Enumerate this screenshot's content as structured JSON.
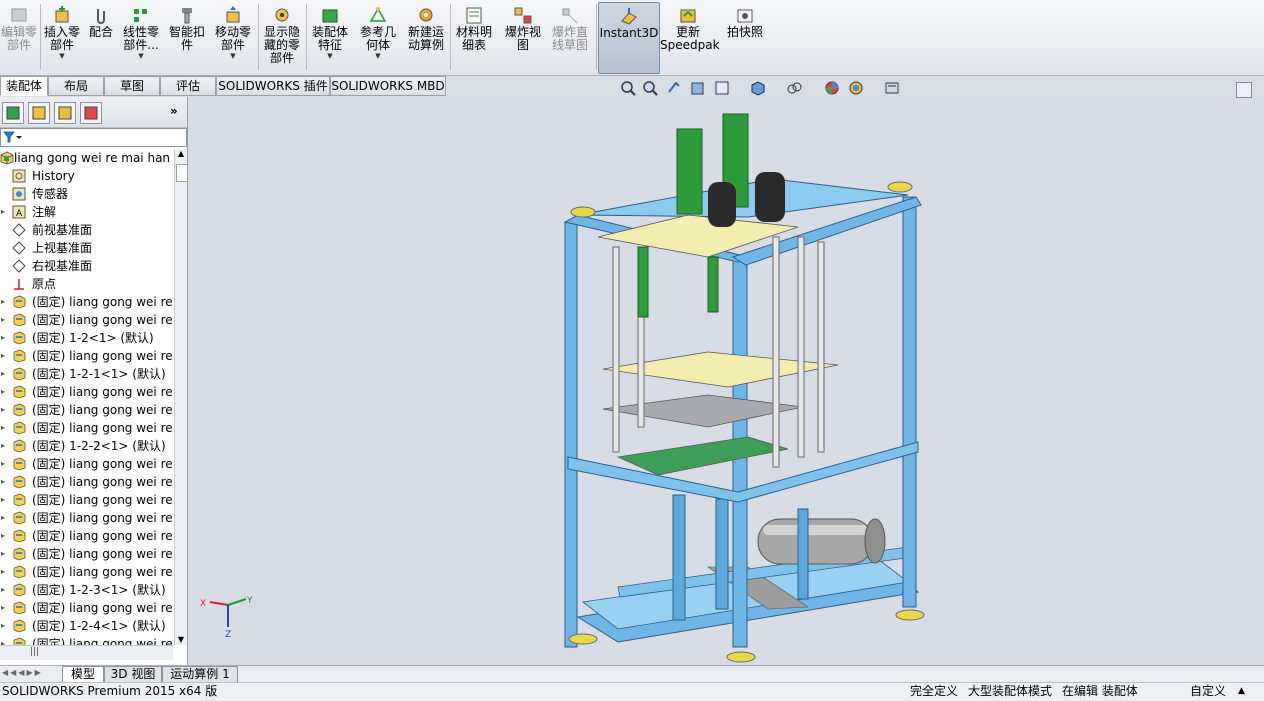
{
  "toolbar": {
    "buttons": [
      {
        "label": "编辑零\n部件",
        "icon": "edit-component-icon",
        "disabled": true
      },
      {
        "label": "插入零\n部件",
        "icon": "insert-component-icon",
        "arrow": true
      },
      {
        "label": "配合",
        "icon": "mate-paperclip-icon"
      },
      {
        "label": "线性零\n部件...",
        "icon": "linear-pattern-icon",
        "arrow": true
      },
      {
        "label": "智能扣\n件",
        "icon": "smart-fastener-icon"
      },
      {
        "label": "移动零\n部件",
        "icon": "move-component-icon",
        "arrow": true
      },
      {
        "label": "显示隐\n藏的零\n部件",
        "icon": "show-hidden-icon"
      },
      {
        "label": "装配体\n特征",
        "icon": "assembly-feature-icon",
        "arrow": true
      },
      {
        "label": "参考几\n何体",
        "icon": "reference-geometry-icon",
        "arrow": true
      },
      {
        "label": "新建运\n动算例",
        "icon": "motion-study-icon"
      },
      {
        "label": "材料明\n细表",
        "icon": "bom-icon"
      },
      {
        "label": "爆炸视\n图",
        "icon": "exploded-view-icon"
      },
      {
        "label": "爆炸直\n线草图",
        "icon": "explode-line-sketch-icon",
        "disabled": true
      },
      {
        "label": "Instant3D",
        "icon": "instant3d-icon",
        "active": true
      },
      {
        "label": "更新\nSpeedpak",
        "icon": "speedpak-icon"
      },
      {
        "label": "拍快照",
        "icon": "snapshot-icon"
      }
    ]
  },
  "command_tabs": [
    "装配体",
    "布局",
    "草图",
    "评估",
    "SOLIDWORKS 插件",
    "SOLIDWORKS MBD"
  ],
  "active_command_tab": "装配体",
  "fm_tabs": [
    "featuremanager-icon",
    "propertymanager-icon",
    "configmanager-icon",
    "displaymanager-icon"
  ],
  "tree": {
    "root": "liang gong wei re mai han j",
    "items": [
      {
        "label": "History",
        "icon": "history-icon"
      },
      {
        "label": "传感器",
        "icon": "sensor-icon"
      },
      {
        "label": "注解",
        "icon": "annotation-icon",
        "expandable": true
      },
      {
        "label": "前视基准面",
        "icon": "plane-icon"
      },
      {
        "label": "上视基准面",
        "icon": "plane-icon"
      },
      {
        "label": "右视基准面",
        "icon": "plane-icon"
      },
      {
        "label": "原点",
        "icon": "origin-icon"
      },
      {
        "label": "(固定) liang gong wei re",
        "icon": "part-icon",
        "expandable": true
      },
      {
        "label": "(固定) liang gong wei re",
        "icon": "part-icon",
        "expandable": true
      },
      {
        "label": "(固定) 1-2<1> (默认)",
        "icon": "part-icon",
        "expandable": true
      },
      {
        "label": "(固定) liang gong wei re",
        "icon": "part-icon",
        "expandable": true
      },
      {
        "label": "(固定) 1-2-1<1> (默认)",
        "icon": "part-icon",
        "expandable": true
      },
      {
        "label": "(固定) liang gong wei re",
        "icon": "part-icon",
        "expandable": true
      },
      {
        "label": "(固定) liang gong wei re",
        "icon": "part-icon",
        "expandable": true
      },
      {
        "label": "(固定) liang gong wei re",
        "icon": "part-icon",
        "expandable": true
      },
      {
        "label": "(固定) 1-2-2<1> (默认)",
        "icon": "part-icon",
        "expandable": true
      },
      {
        "label": "(固定) liang gong wei re",
        "icon": "part-icon",
        "expandable": true
      },
      {
        "label": "(固定) liang gong wei re",
        "icon": "part-icon",
        "expandable": true
      },
      {
        "label": "(固定) liang gong wei re",
        "icon": "part-icon",
        "expandable": true
      },
      {
        "label": "(固定) liang gong wei re",
        "icon": "part-icon",
        "expandable": true
      },
      {
        "label": "(固定) liang gong wei re",
        "icon": "part-icon",
        "expandable": true
      },
      {
        "label": "(固定) liang gong wei re",
        "icon": "part-icon",
        "expandable": true
      },
      {
        "label": "(固定) liang gong wei re",
        "icon": "part-icon",
        "expandable": true
      },
      {
        "label": "(固定) 1-2-3<1> (默认)",
        "icon": "part-icon",
        "expandable": true
      },
      {
        "label": "(固定) liang gong wei re",
        "icon": "part-icon",
        "expandable": true
      },
      {
        "label": "(固定) 1-2-4<1> (默认)",
        "icon": "part-icon",
        "expandable": true
      },
      {
        "label": "(固定) liang gong wei re",
        "icon": "part-icon",
        "expandable": true
      }
    ]
  },
  "model_tabs": [
    "模型",
    "3D 视图",
    "运动算例 1"
  ],
  "active_model_tab": "模型",
  "status": {
    "app": "SOLIDWORKS Premium 2015 x64 版",
    "definition": "完全定义",
    "mode": "大型装配体模式",
    "editing": "在编辑 装配体",
    "units": "自定义"
  },
  "triad": {
    "x": "X",
    "y": "Y",
    "z": "Z"
  },
  "colors": {
    "frame": "#6fb6e6",
    "cylinder": "#2e9b3a",
    "plate": "#f3eeb0",
    "tank": "#9a9a9a",
    "pad": "#e6d84a"
  }
}
